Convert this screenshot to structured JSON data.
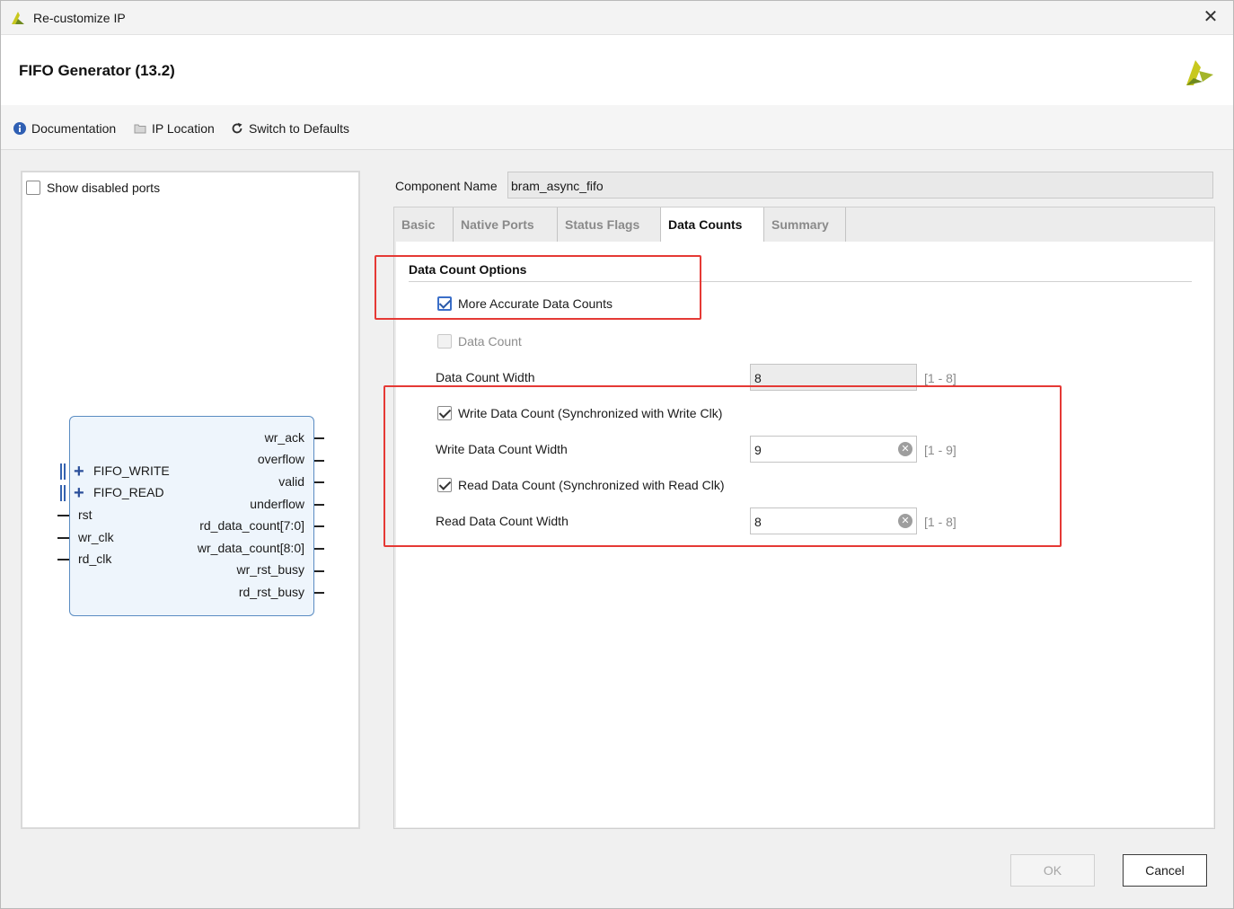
{
  "window": {
    "title": "Re-customize IP",
    "close_glyph": "✕"
  },
  "header": {
    "ip_title": "FIFO Generator (13.2)"
  },
  "toolbar": {
    "documentation": "Documentation",
    "ip_location": "IP Location",
    "switch_defaults": "Switch to Defaults"
  },
  "left_panel": {
    "show_disabled_ports": "Show disabled ports",
    "show_disabled_checked": false,
    "block": {
      "left_ports": [
        "FIFO_WRITE",
        "FIFO_READ",
        "rst",
        "wr_clk",
        "rd_clk"
      ],
      "right_ports": [
        "wr_ack",
        "overflow",
        "valid",
        "underflow",
        "rd_data_count[7:0]",
        "wr_data_count[8:0]",
        "wr_rst_busy",
        "rd_rst_busy"
      ],
      "plus_glyph": "+"
    }
  },
  "component": {
    "label": "Component Name",
    "value": "bram_async_fifo"
  },
  "tabs": [
    {
      "label": "Basic",
      "active": false
    },
    {
      "label": "Native Ports",
      "active": false
    },
    {
      "label": "Status Flags",
      "active": false
    },
    {
      "label": "Data Counts",
      "active": true
    },
    {
      "label": "Summary",
      "active": false
    }
  ],
  "data_counts": {
    "section_title": "Data Count Options",
    "more_accurate": {
      "label": "More Accurate Data Counts",
      "checked": true
    },
    "data_count": {
      "label": "Data Count",
      "checked": false,
      "disabled": true
    },
    "data_count_width": {
      "label": "Data Count Width",
      "value": "8",
      "range": "[1 - 8]"
    },
    "write_data_count": {
      "label": "Write Data Count (Synchronized with Write Clk)",
      "checked": true
    },
    "write_data_count_width": {
      "label": "Write Data Count Width",
      "value": "9",
      "range": "[1 - 9]"
    },
    "read_data_count": {
      "label": "Read Data Count (Synchronized with Read Clk)",
      "checked": true
    },
    "read_data_count_width": {
      "label": "Read Data Count Width",
      "value": "8",
      "range": "[1 - 8]"
    },
    "clear_glyph": "✕"
  },
  "buttons": {
    "ok": "OK",
    "cancel": "Cancel"
  },
  "colors": {
    "highlight_red": "#e53935",
    "block_fill": "#eef5fc",
    "block_border": "#5a8cc2",
    "logo_yellow": "#c8c81e",
    "logo_green": "#6f8a1e"
  }
}
